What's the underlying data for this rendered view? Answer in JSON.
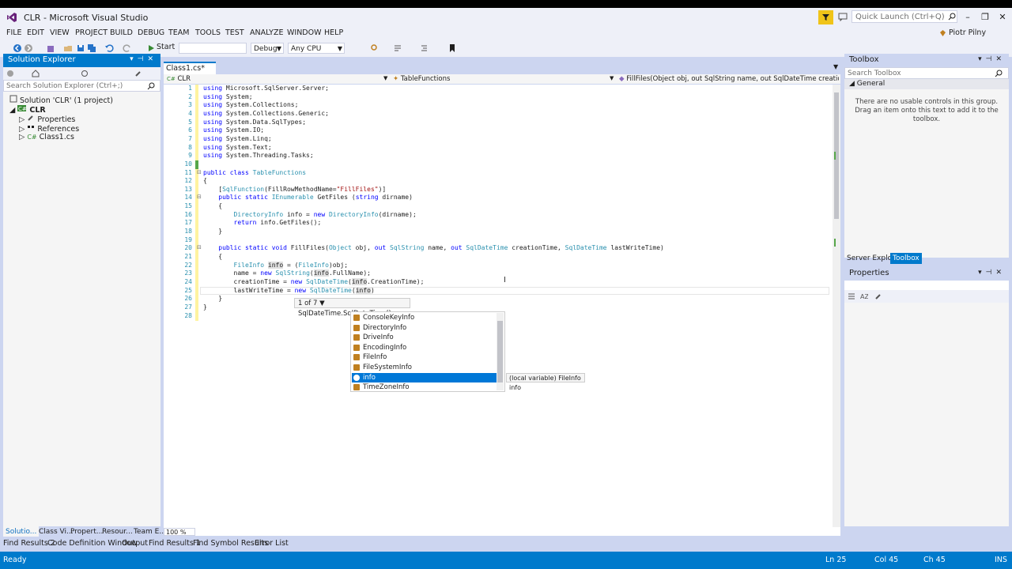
{
  "window": {
    "title": "CLR - Microsoft Visual Studio",
    "quick_launch_placeholder": "Quick Launch (Ctrl+Q)",
    "user": "Piotr Pilny"
  },
  "menu": [
    "FILE",
    "EDIT",
    "VIEW",
    "PROJECT",
    "BUILD",
    "DEBUG",
    "TEAM",
    "TOOLS",
    "TEST",
    "ANALYZE",
    "WINDOW",
    "HELP"
  ],
  "toolbar": {
    "start_label": "Start",
    "config": "Debug",
    "platform": "Any CPU"
  },
  "solution_explorer": {
    "title": "Solution Explorer",
    "search_placeholder": "Search Solution Explorer (Ctrl+;)",
    "items": [
      {
        "label": "Solution 'CLR' (1 project)"
      },
      {
        "label": "CLR"
      },
      {
        "label": "Properties"
      },
      {
        "label": "References"
      },
      {
        "label": "Class1.cs"
      }
    ],
    "tabs": [
      "Solutio...",
      "Class Vi...",
      "Propert...",
      "Resour...",
      "Team E..."
    ]
  },
  "editor": {
    "tab_label": "Class1.cs*",
    "nav": {
      "project": "CLR",
      "class": "TableFunctions",
      "member": "FillFiles(Object obj, out SqlString name, out SqlDateTime creationTime, Sq"
    },
    "zoom": "100 %",
    "lines": [
      {
        "n": "1",
        "html": "<span class=\"kw\">using</span> Microsoft.SqlServer.Server;"
      },
      {
        "n": "2",
        "html": "<span class=\"kw\">using</span> System;"
      },
      {
        "n": "3",
        "html": "<span class=\"kw\">using</span> System.Collections;"
      },
      {
        "n": "4",
        "html": "<span class=\"kw\">using</span> System.Collections.Generic;"
      },
      {
        "n": "5",
        "html": "<span class=\"kw\">using</span> System.Data.SqlTypes;"
      },
      {
        "n": "6",
        "html": "<span class=\"kw\">using</span> System.IO;"
      },
      {
        "n": "7",
        "html": "<span class=\"kw\">using</span> System.Linq;"
      },
      {
        "n": "8",
        "html": "<span class=\"kw\">using</span> System.Text;"
      },
      {
        "n": "9",
        "html": "<span class=\"kw\">using</span> System.Threading.Tasks;"
      },
      {
        "n": "10",
        "html": ""
      },
      {
        "n": "11",
        "html": "<span class=\"kw\">public class</span> <span class=\"ty\">TableFunctions</span>"
      },
      {
        "n": "12",
        "html": "{"
      },
      {
        "n": "13",
        "html": "    [<span class=\"ty\">SqlFunction</span>(FillRowMethodName=<span class=\"str\">\"FillFiles\"</span>)]"
      },
      {
        "n": "14",
        "html": "    <span class=\"kw\">public static</span> <span class=\"ty\">IEnumerable</span> GetFiles (<span class=\"kw\">string</span> dirname)"
      },
      {
        "n": "15",
        "html": "    {"
      },
      {
        "n": "16",
        "html": "        <span class=\"ty\">DirectoryInfo</span> info = <span class=\"kw\">new</span> <span class=\"ty\">DirectoryInfo</span>(dirname);"
      },
      {
        "n": "17",
        "html": "        <span class=\"kw\">return</span> info.GetFiles();"
      },
      {
        "n": "18",
        "html": "    }"
      },
      {
        "n": "19",
        "html": ""
      },
      {
        "n": "20",
        "html": "    <span class=\"kw\">public static void</span> FillFiles(<span class=\"ty\">Object</span> obj, <span class=\"kw\">out</span> <span class=\"ty\">SqlString</span> name, <span class=\"kw\">out</span> <span class=\"ty\">SqlDateTime</span> creationTime, <span class=\"ty\">SqlDateTime</span> lastWriteTime)"
      },
      {
        "n": "21",
        "html": "    {"
      },
      {
        "n": "22",
        "html": "        <span class=\"ty\">FileInfo</span> <span class=\"hl\">info</span> = (<span class=\"ty\">FileInfo</span>)obj;"
      },
      {
        "n": "23",
        "html": "        name = <span class=\"kw\">new</span> <span class=\"ty\">SqlString</span>(<span class=\"hl\">info</span>.FullName);"
      },
      {
        "n": "24",
        "html": "        creationTime = <span class=\"kw\">new</span> <span class=\"ty\">SqlDateTime</span>(<span class=\"hl\">info</span>.CreationTime);"
      },
      {
        "n": "25",
        "html": "        lastWriteTime = <span class=\"kw\">new</span> <span class=\"ty\">SqlDateTime</span>(<span class=\"hl\">info</span>)"
      },
      {
        "n": "26",
        "html": "    }"
      },
      {
        "n": "27",
        "html": "}"
      },
      {
        "n": "28",
        "html": ""
      }
    ],
    "signature_help": "1 of 7 ▼ SqlDateTime.SqlDateTime()",
    "completion_items": [
      {
        "label": "ConsoleKeyInfo"
      },
      {
        "label": "DirectoryInfo"
      },
      {
        "label": "DriveInfo"
      },
      {
        "label": "EncodingInfo"
      },
      {
        "label": "FileInfo"
      },
      {
        "label": "FileSystemInfo"
      },
      {
        "label": "info"
      },
      {
        "label": "TimeZoneInfo"
      }
    ],
    "completion_selected": 6,
    "completion_tooltip": "(local variable) FileInfo info"
  },
  "toolbox": {
    "title": "Toolbox",
    "search_placeholder": "Search Toolbox",
    "group": "General",
    "empty_text": "There are no usable controls in this group. Drag an item onto this text to add it to the toolbox.",
    "tabs": [
      "Server Explorer",
      "Toolbox"
    ]
  },
  "properties": {
    "title": "Properties"
  },
  "bottom_tabs": [
    "Find Results 2",
    "Code Definition Window",
    "Output",
    "Find Results 1",
    "Find Symbol Results",
    "Error List"
  ],
  "status": {
    "left": "Ready",
    "ln": "Ln 25",
    "col": "Col 45",
    "ch": "Ch 45",
    "mode": "INS"
  }
}
